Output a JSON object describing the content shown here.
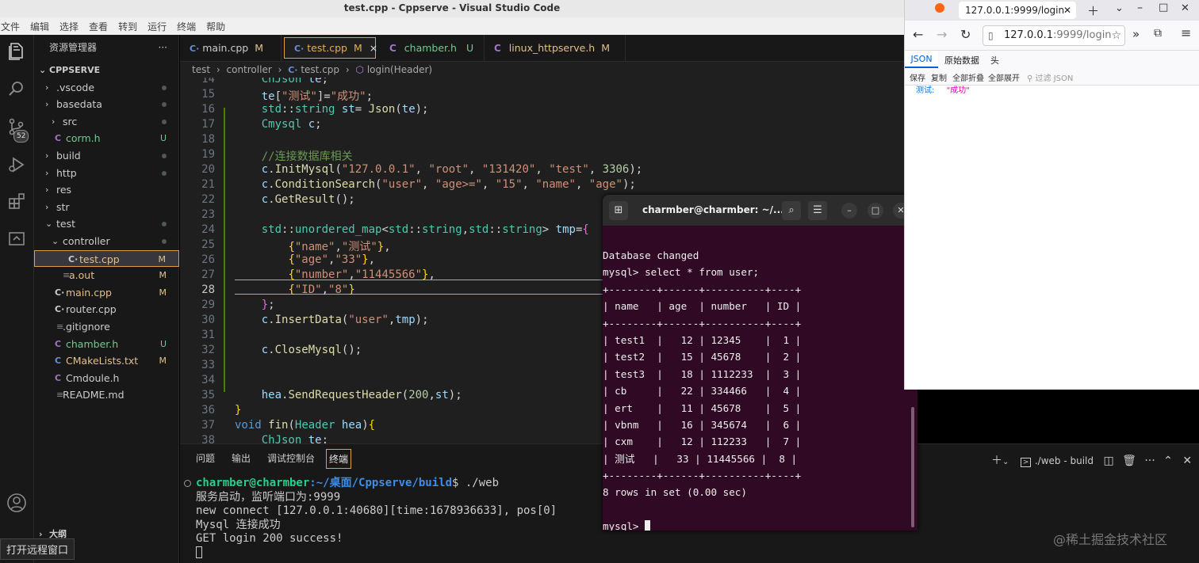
{
  "window": {
    "title": "test.cpp - Cppserve - Visual Studio Code"
  },
  "menu": [
    "文件",
    "编辑",
    "选择",
    "查看",
    "转到",
    "运行",
    "终端",
    "帮助"
  ],
  "activity": {
    "scm_badge": "52"
  },
  "explorer": {
    "header": "资源管理器",
    "more": "···",
    "root": "CPPSERVE",
    "items": [
      {
        "label": ".vscode",
        "kind": "folder",
        "status": "dot"
      },
      {
        "label": "basedata",
        "kind": "folder",
        "status": "dot"
      },
      {
        "label": "src",
        "kind": "folder",
        "status": "dot"
      },
      {
        "label": "corm.h",
        "kind": "c",
        "status": "U"
      },
      {
        "label": "build",
        "kind": "folder",
        "status": "dot"
      },
      {
        "label": "http",
        "kind": "folder",
        "status": "dot"
      },
      {
        "label": "res",
        "kind": "folder",
        "status": ""
      },
      {
        "label": "str",
        "kind": "folder",
        "status": ""
      },
      {
        "label": "test",
        "kind": "folder-open",
        "status": "dot"
      },
      {
        "label": "controller",
        "kind": "folder-open",
        "status": "dot"
      },
      {
        "label": "test.cpp",
        "kind": "cpp",
        "status": "M"
      },
      {
        "label": "a.out",
        "kind": "file",
        "status": "M"
      },
      {
        "label": "main.cpp",
        "kind": "cpp",
        "status": "M"
      },
      {
        "label": "router.cpp",
        "kind": "cpp",
        "status": ""
      },
      {
        "label": ".gitignore",
        "kind": "file",
        "status": ""
      },
      {
        "label": "chamber.h",
        "kind": "c",
        "status": "U"
      },
      {
        "label": "CMakeLists.txt",
        "kind": "m",
        "status": "M"
      },
      {
        "label": "Cmdoule.h",
        "kind": "c",
        "status": ""
      },
      {
        "label": "README.md",
        "kind": "file",
        "status": ""
      }
    ],
    "outline": "大纲"
  },
  "tabs": [
    {
      "label": "main.cpp",
      "status": "M",
      "icon": "cpp-icon"
    },
    {
      "label": "test.cpp",
      "status": "M",
      "icon": "cpp-icon",
      "close": "×"
    },
    {
      "label": "chamber.h",
      "status": "U",
      "icon": "c-icon"
    },
    {
      "label": "linux_httpserve.h",
      "status": "M",
      "icon": "c-icon"
    }
  ],
  "breadcrumb": [
    "test",
    "controller",
    "test.cpp",
    "login(Header)"
  ],
  "code_lines": [
    14,
    15,
    16,
    17,
    18,
    19,
    20,
    21,
    22,
    23,
    24,
    25,
    26,
    27,
    28,
    29,
    30,
    31,
    32,
    33,
    34,
    35,
    36,
    37,
    38
  ],
  "panel": {
    "tabs": [
      "问题",
      "输出",
      "调试控制台",
      "终端"
    ],
    "active_tab": "终端",
    "terminal_name": "./web - build",
    "prompt_user": "charmber@charmber",
    "prompt_path": ":~/桌面/Cppserve/build",
    "prompt_cmd": "$ ./web",
    "output": [
      "服务启动，监听端口为:9999",
      "new connect [127.0.0.1:40680][time:1678936633], pos[0]",
      "Mysql 连接成功",
      "GET login 200 success!"
    ]
  },
  "gnome_terminal": {
    "title": "charmber@charmber: ~/...",
    "lines": [
      "Database changed",
      "mysql> select * from user;",
      "+--------+------+----------+----+",
      "| name   | age  | number   | ID |",
      "+--------+------+----------+----+",
      "| test1  |   12 | 12345    |  1 |",
      "| test2  |   15 | 45678    |  2 |",
      "| test3  |   18 | 1112233  |  3 |",
      "| cb     |   22 | 334466   |  4 |",
      "| ert    |   11 | 45678    |  5 |",
      "| vbnm   |   16 | 345674   |  6 |",
      "| cxm    |   12 | 112233   |  7 |",
      "| 测试   |   33 | 11445566 |  8 |",
      "+--------+------+----------+----+",
      "8 rows in set (0.00 sec)",
      "",
      "mysql> "
    ]
  },
  "firefox": {
    "tab_title": "127.0.0.1:9999/login",
    "url_host": "127.0.0.1",
    "url_rest": ":9999/login",
    "json_tabs": [
      "JSON",
      "原始数据",
      "头"
    ],
    "tools": [
      "保存",
      "复制",
      "全部折叠",
      "全部展开"
    ],
    "filter_placeholder": "过滤 JSON",
    "key": "测试:",
    "value": "\"成功\""
  },
  "tooltip": "打开远程窗口",
  "watermark": "@稀土掘金技术社区",
  "colors": {
    "accent": "#e0a040",
    "terminal_bg": "#300a24",
    "prompt_green": "#23d18b",
    "prompt_blue": "#3b8eea"
  }
}
